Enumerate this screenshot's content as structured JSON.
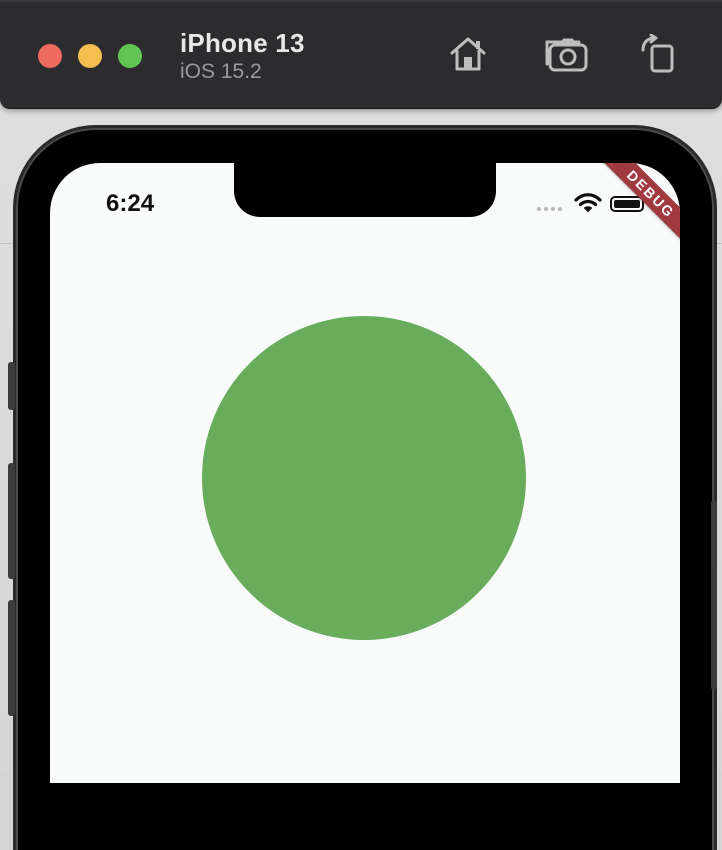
{
  "simulator": {
    "device_name": "iPhone 13",
    "os_version": "iOS 15.2",
    "toolbar": {
      "home_icon": "home-icon",
      "screenshot_icon": "camera-icon",
      "rotate_icon": "rotate-icon"
    },
    "window_controls": [
      "close",
      "minimize",
      "zoom"
    ]
  },
  "status_bar": {
    "time": "6:24",
    "icons": [
      "signal-dots-icon",
      "wifi-icon",
      "battery-icon"
    ]
  },
  "app": {
    "debug_banner": "DEBUG",
    "circle_color": "#69ad5c",
    "background_color": "#f8fbfa"
  }
}
